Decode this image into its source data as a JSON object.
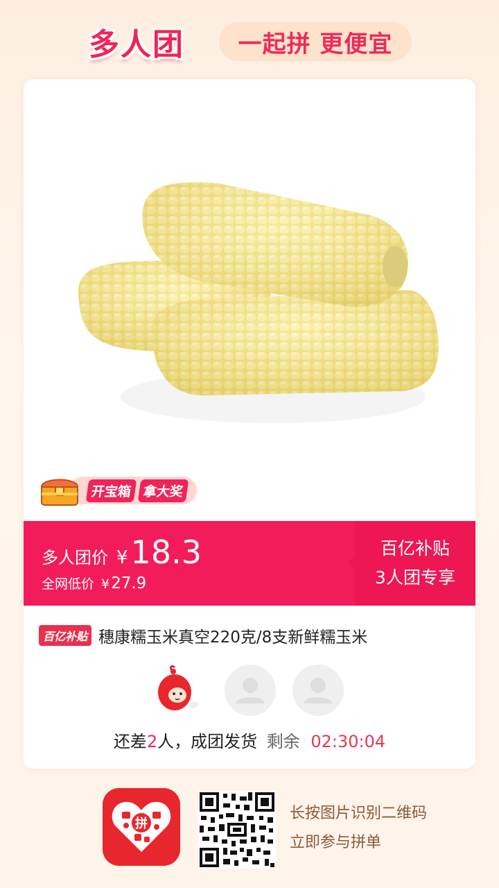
{
  "header": {
    "brand": "多人团",
    "slogan": "一起拼 更便宜"
  },
  "promo": {
    "treasure_label_1": "开宝箱",
    "treasure_label_2": "拿大奖"
  },
  "price": {
    "label": "多人团价",
    "currency": "¥",
    "value": "18.3",
    "compare_label": "全网低价",
    "compare_currency": "¥",
    "compare_value": "27.9"
  },
  "subsidy": {
    "line1": "百亿补贴",
    "line2": "3人团专享",
    "tag": "百亿补贴"
  },
  "product": {
    "title": "穗康糯玉米真空220克/8支新鲜糯玉米"
  },
  "group_status": {
    "prefix": "还差",
    "remaining_count": "2",
    "suffix": "人，成团发货",
    "countdown_label": "剩余",
    "countdown": "02:30:04"
  },
  "footer": {
    "scan_line1": "长按图片识别二维码",
    "scan_line2": "立即参与拼单",
    "app_icon_char": "拼"
  },
  "colors": {
    "accent": "#f31c5a",
    "subsidy_box": "#ee1653",
    "slogan_bg": "#fde2cc",
    "app_icon": "#e8262e"
  }
}
